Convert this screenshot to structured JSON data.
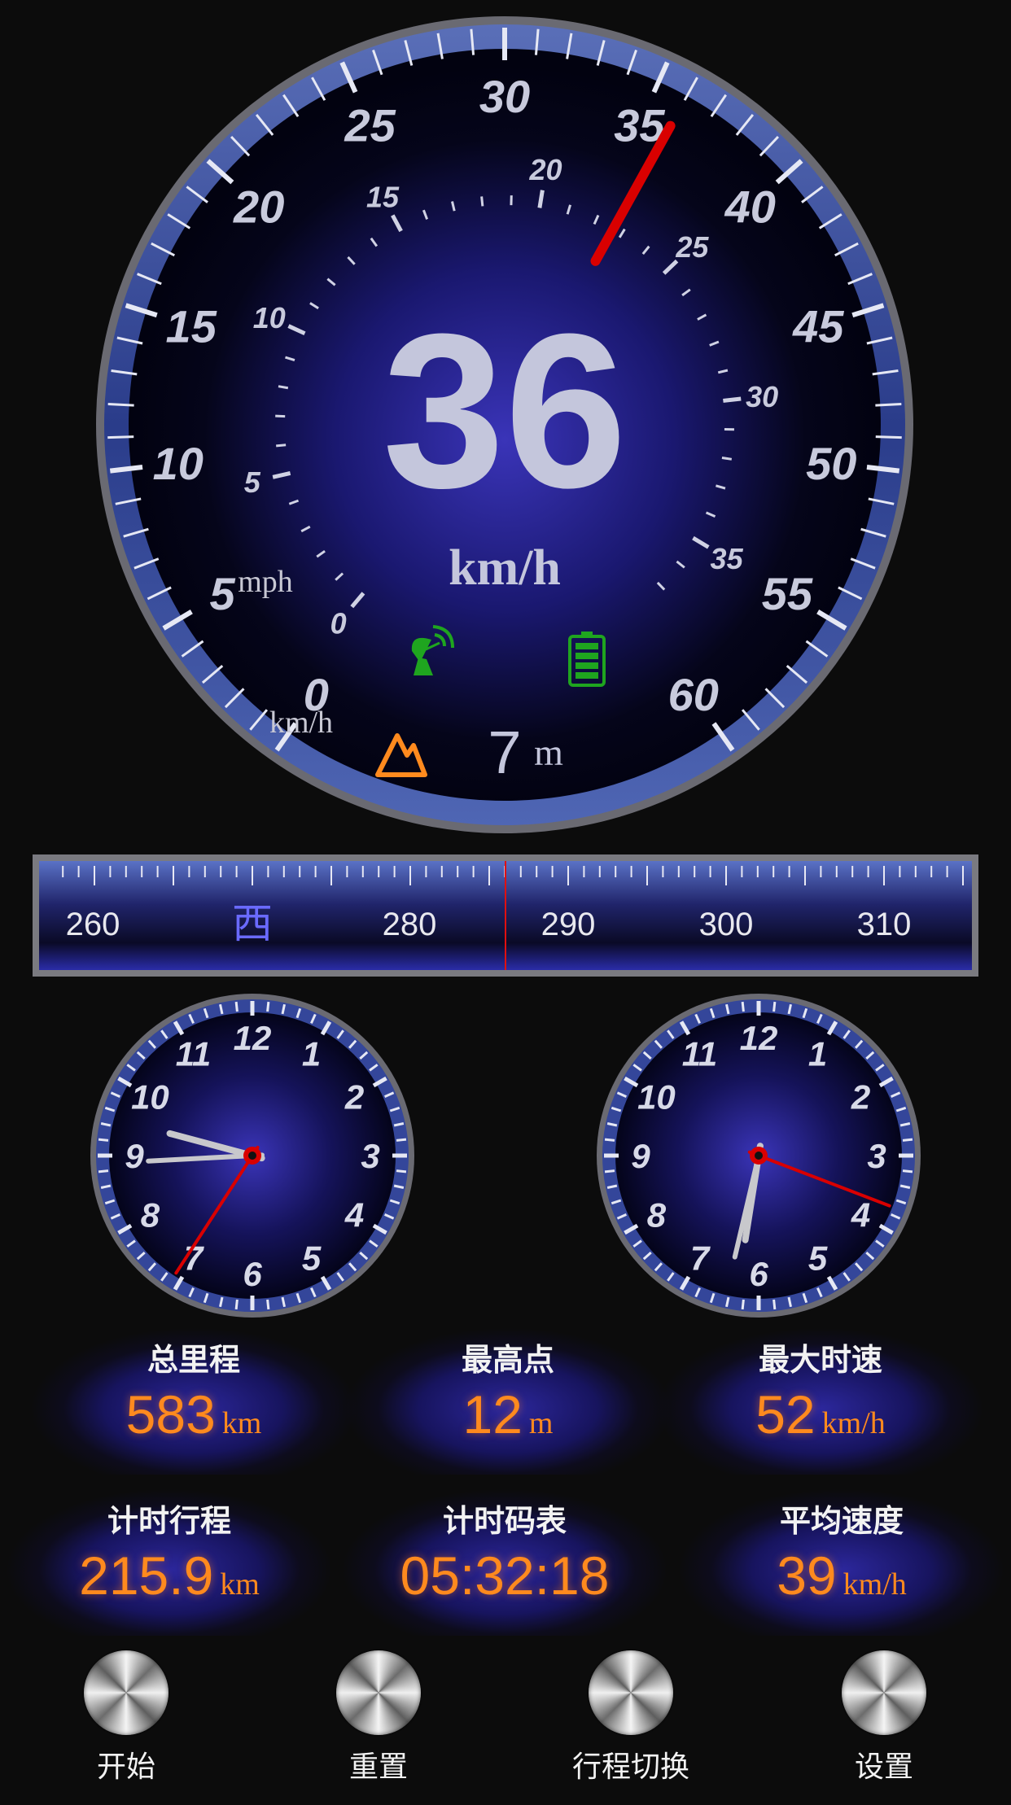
{
  "speedometer": {
    "speed_value": "36",
    "speed_unit": "km/h",
    "kmh_scale_label": "km/h",
    "mph_scale_label": "mph",
    "kmh_ticks": [
      "0",
      "5",
      "10",
      "15",
      "20",
      "25",
      "30",
      "35",
      "40",
      "45",
      "50",
      "55",
      "60"
    ],
    "mph_ticks": [
      "0",
      "5",
      "10",
      "15",
      "20",
      "25",
      "30",
      "35"
    ],
    "needle_value_kmh": 36,
    "altitude_value": "7",
    "altitude_unit": "m",
    "gps_icon": "satellite-dish-icon",
    "battery_icon": "battery-icon",
    "altitude_icon": "mountain-icon",
    "gps_color": "#1fa51f",
    "altitude_color": "#ff8a1e",
    "needle_color": "#d90000"
  },
  "compass": {
    "labels": [
      "260",
      "西",
      "280",
      "290",
      "300",
      "310"
    ],
    "heading_deg": 286
  },
  "clocks": {
    "numerals": [
      "12",
      "1",
      "2",
      "3",
      "4",
      "5",
      "6",
      "7",
      "8",
      "9",
      "10",
      "11"
    ],
    "left": {
      "hour": 9.5,
      "minute": 44.5,
      "second": 35.5
    },
    "right": {
      "hour": 6.3,
      "minute": 32.2,
      "second": 18.5
    }
  },
  "stats": [
    {
      "label": "总里程",
      "value": "583",
      "unit": "km"
    },
    {
      "label": "最高点",
      "value": "12",
      "unit": "m"
    },
    {
      "label": "最大时速",
      "value": "52",
      "unit": "km/h"
    },
    {
      "label": "计时行程",
      "value": "215.9",
      "unit": "km"
    },
    {
      "label": "计时码表",
      "value": "05:32:18",
      "unit": ""
    },
    {
      "label": "平均速度",
      "value": "39",
      "unit": "km/h"
    }
  ],
  "buttons": [
    {
      "label": "开始"
    },
    {
      "label": "重置"
    },
    {
      "label": "行程切换"
    },
    {
      "label": "设置"
    }
  ]
}
